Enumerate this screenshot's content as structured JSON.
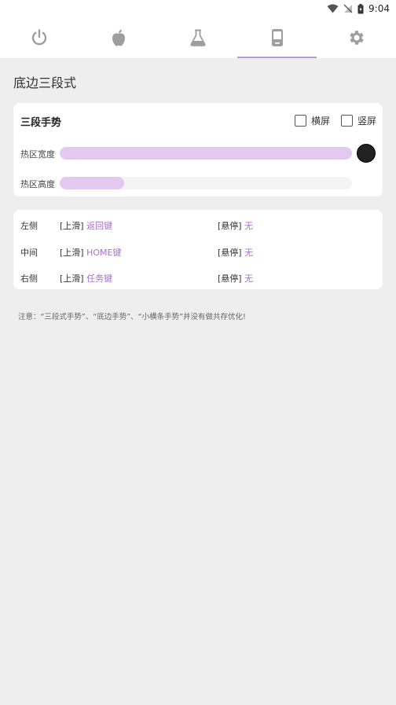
{
  "status_bar": {
    "time": "9:04"
  },
  "tabs": [
    {
      "icon": "power-icon",
      "active": false
    },
    {
      "icon": "apple-icon",
      "active": false
    },
    {
      "icon": "flask-icon",
      "active": false
    },
    {
      "icon": "phone-icon",
      "active": true
    },
    {
      "icon": "gear-icon",
      "active": false
    }
  ],
  "section_title": "底边三段式",
  "gesture_card": {
    "title": "三段手势",
    "landscape_label": "横屏",
    "portrait_label": "竖屏",
    "landscape_checked": false,
    "portrait_checked": false,
    "width_label": "热区宽度",
    "height_label": "热区高度",
    "width_value_fraction": 1.0,
    "height_value_fraction": 0.22,
    "accent_color": "#a772c9"
  },
  "actions": [
    {
      "position": "左侧",
      "swipe_prefix": "[上滑]",
      "swipe_action": "返回键",
      "hover_prefix": "[悬停]",
      "hover_action": "无"
    },
    {
      "position": "中间",
      "swipe_prefix": "[上滑]",
      "swipe_action": "HOME键",
      "hover_prefix": "[悬停]",
      "hover_action": "无"
    },
    {
      "position": "右侧",
      "swipe_prefix": "[上滑]",
      "swipe_action": "任务键",
      "hover_prefix": "[悬停]",
      "hover_action": "无"
    }
  ],
  "note": "注意：“三段式手势”、“底边手势”、“小横条手势”并没有做共存优化!"
}
